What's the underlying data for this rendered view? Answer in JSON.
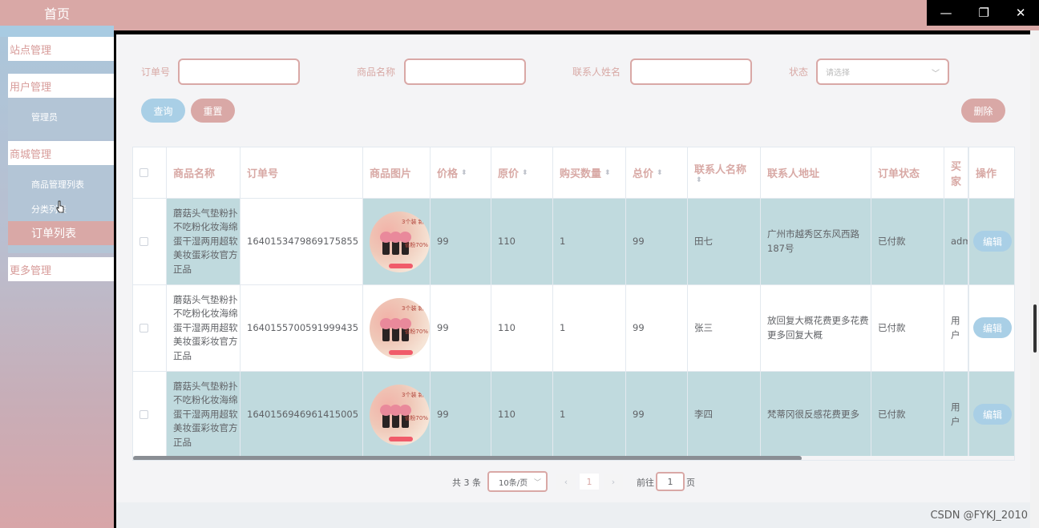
{
  "sidebar": {
    "home": "首页",
    "groups": [
      {
        "label": "站点管理"
      },
      {
        "label": "用户管理",
        "items": [
          "管理员"
        ]
      },
      {
        "label": "商城管理",
        "items": [
          "商品管理列表",
          "分类列表",
          "订单列表"
        ]
      },
      {
        "label": "更多管理"
      }
    ],
    "active_item": "订单列表"
  },
  "window_controls": {
    "minimize": "—",
    "restore": "❐",
    "close": "✕"
  },
  "filters": {
    "order_no_label": "订单号",
    "product_name_label": "商品名称",
    "contact_name_label": "联系人姓名",
    "status_label": "状态",
    "status_placeholder": "请选择"
  },
  "buttons": {
    "query": "查询",
    "reset": "重置",
    "delete": "删除",
    "edit": "编辑"
  },
  "table": {
    "columns": [
      "商品名称",
      "订单号",
      "商品图片",
      "价格",
      "原价",
      "购买数量",
      "总价",
      "联系人名称",
      "联系人地址",
      "订单状态",
      "买家",
      "操作"
    ],
    "sortable": [
      "价格",
      "原价",
      "购买数量",
      "总价",
      "联系人名称"
    ],
    "rows": [
      {
        "product": "蘑菇头气垫粉扑不吃粉化妆海绵蛋干湿两用超软美妆蛋彩妆官方正品",
        "order_no": "1640153479869175855",
        "price": "99",
        "original_price": "110",
        "qty": "1",
        "total": "99",
        "contact": "田七",
        "address": "广州市越秀区东风西路187号",
        "status": "已付款",
        "buyer": "admin"
      },
      {
        "product": "蘑菇头气垫粉扑不吃粉化妆海绵蛋干湿两用超软美妆蛋彩妆官方正品",
        "order_no": "1640155700591999435",
        "price": "99",
        "original_price": "110",
        "qty": "1",
        "total": "99",
        "contact": "张三",
        "address": "放回复大概花费更多花费更多回复大概",
        "status": "已付款",
        "buyer": "用户"
      },
      {
        "product": "蘑菇头气垫粉扑不吃粉化妆海绵蛋干湿两用超软美妆蛋彩妆官方正品",
        "order_no": "1640156946961415005",
        "price": "99",
        "original_price": "110",
        "qty": "1",
        "total": "99",
        "contact": "李四",
        "address": "梵蒂冈很反感花费更多",
        "status": "已付款",
        "buyer": "用户"
      }
    ],
    "image_texts": {
      "title": "3个装 新升",
      "tag": "省粉70%"
    }
  },
  "pagination": {
    "total": "共 3 条",
    "page_size": "10条/页",
    "prev": "‹",
    "next": "›",
    "current": "1",
    "goto_label": "前往",
    "goto_value": "1",
    "page_suffix": "页"
  },
  "watermark": "CSDN @FYKJ_2010",
  "colors": {
    "primary_pink": "#d9a8a6",
    "primary_blue": "#a9cfe6",
    "row_bg": "#c0dade"
  }
}
